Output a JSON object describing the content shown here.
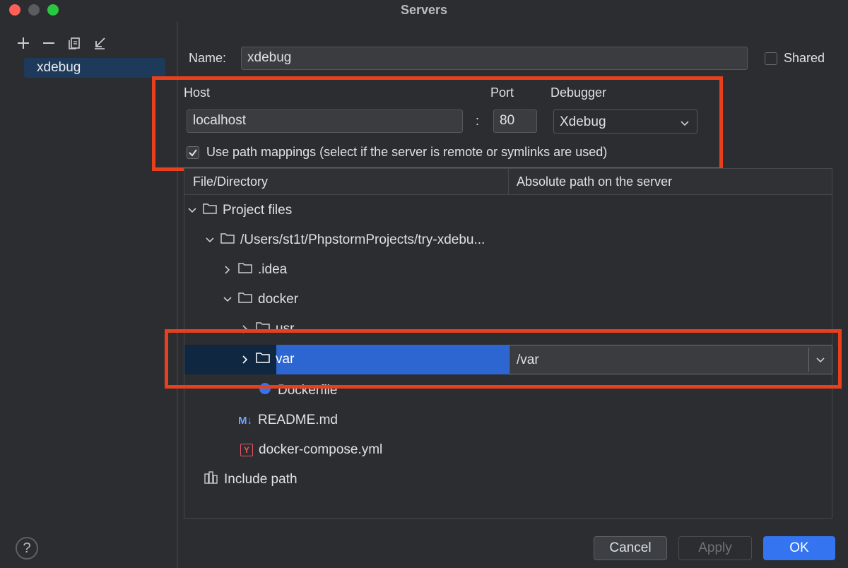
{
  "window": {
    "title": "Servers"
  },
  "sidebar": {
    "tools": [
      "add-icon",
      "remove-icon",
      "copy-icon",
      "import-icon"
    ],
    "items": [
      {
        "label": "xdebug",
        "selected": true
      }
    ]
  },
  "form": {
    "name_label": "Name:",
    "name_value": "xdebug",
    "shared_label": "Shared",
    "shared_checked": false,
    "host_label": "Host",
    "host_value": "localhost",
    "colon": ":",
    "port_label": "Port",
    "port_value": "80",
    "debugger_label": "Debugger",
    "debugger_value": "Xdebug",
    "path_mappings_label": "Use path mappings (select if the server is remote or symlinks are used)",
    "path_mappings_checked": true
  },
  "table": {
    "headers": [
      "File/Directory",
      "Absolute path on the server"
    ],
    "rows": [
      {
        "label": "Project files",
        "icon": "folder-icon",
        "expanded": true
      },
      {
        "label": "/Users/st1t/PhpstormProjects/try-xdebu...",
        "icon": "folder-icon",
        "expanded": true
      },
      {
        "label": ".idea",
        "icon": "folder-icon",
        "expanded": false
      },
      {
        "label": "docker",
        "icon": "folder-icon",
        "expanded": true
      },
      {
        "label": "usr",
        "icon": "folder-icon",
        "expanded": false
      },
      {
        "label": "var",
        "icon": "folder-icon",
        "expanded": false,
        "selected": true,
        "server_path": "/var"
      },
      {
        "label": "Dockerfile",
        "icon": "docker-icon"
      },
      {
        "label": "README.md",
        "icon": "markdown-icon",
        "icon_text": "M↓"
      },
      {
        "label": "docker-compose.yml",
        "icon": "yaml-icon",
        "icon_text": "Y"
      },
      {
        "label": "Include path",
        "icon": "library-icon"
      }
    ]
  },
  "buttons": {
    "help": "?",
    "cancel": "Cancel",
    "apply": "Apply",
    "ok": "OK"
  },
  "colors": {
    "accent": "#3574f0",
    "selection": "#2d66d0",
    "annotation": "#e8401c",
    "background": "#2b2d30"
  }
}
